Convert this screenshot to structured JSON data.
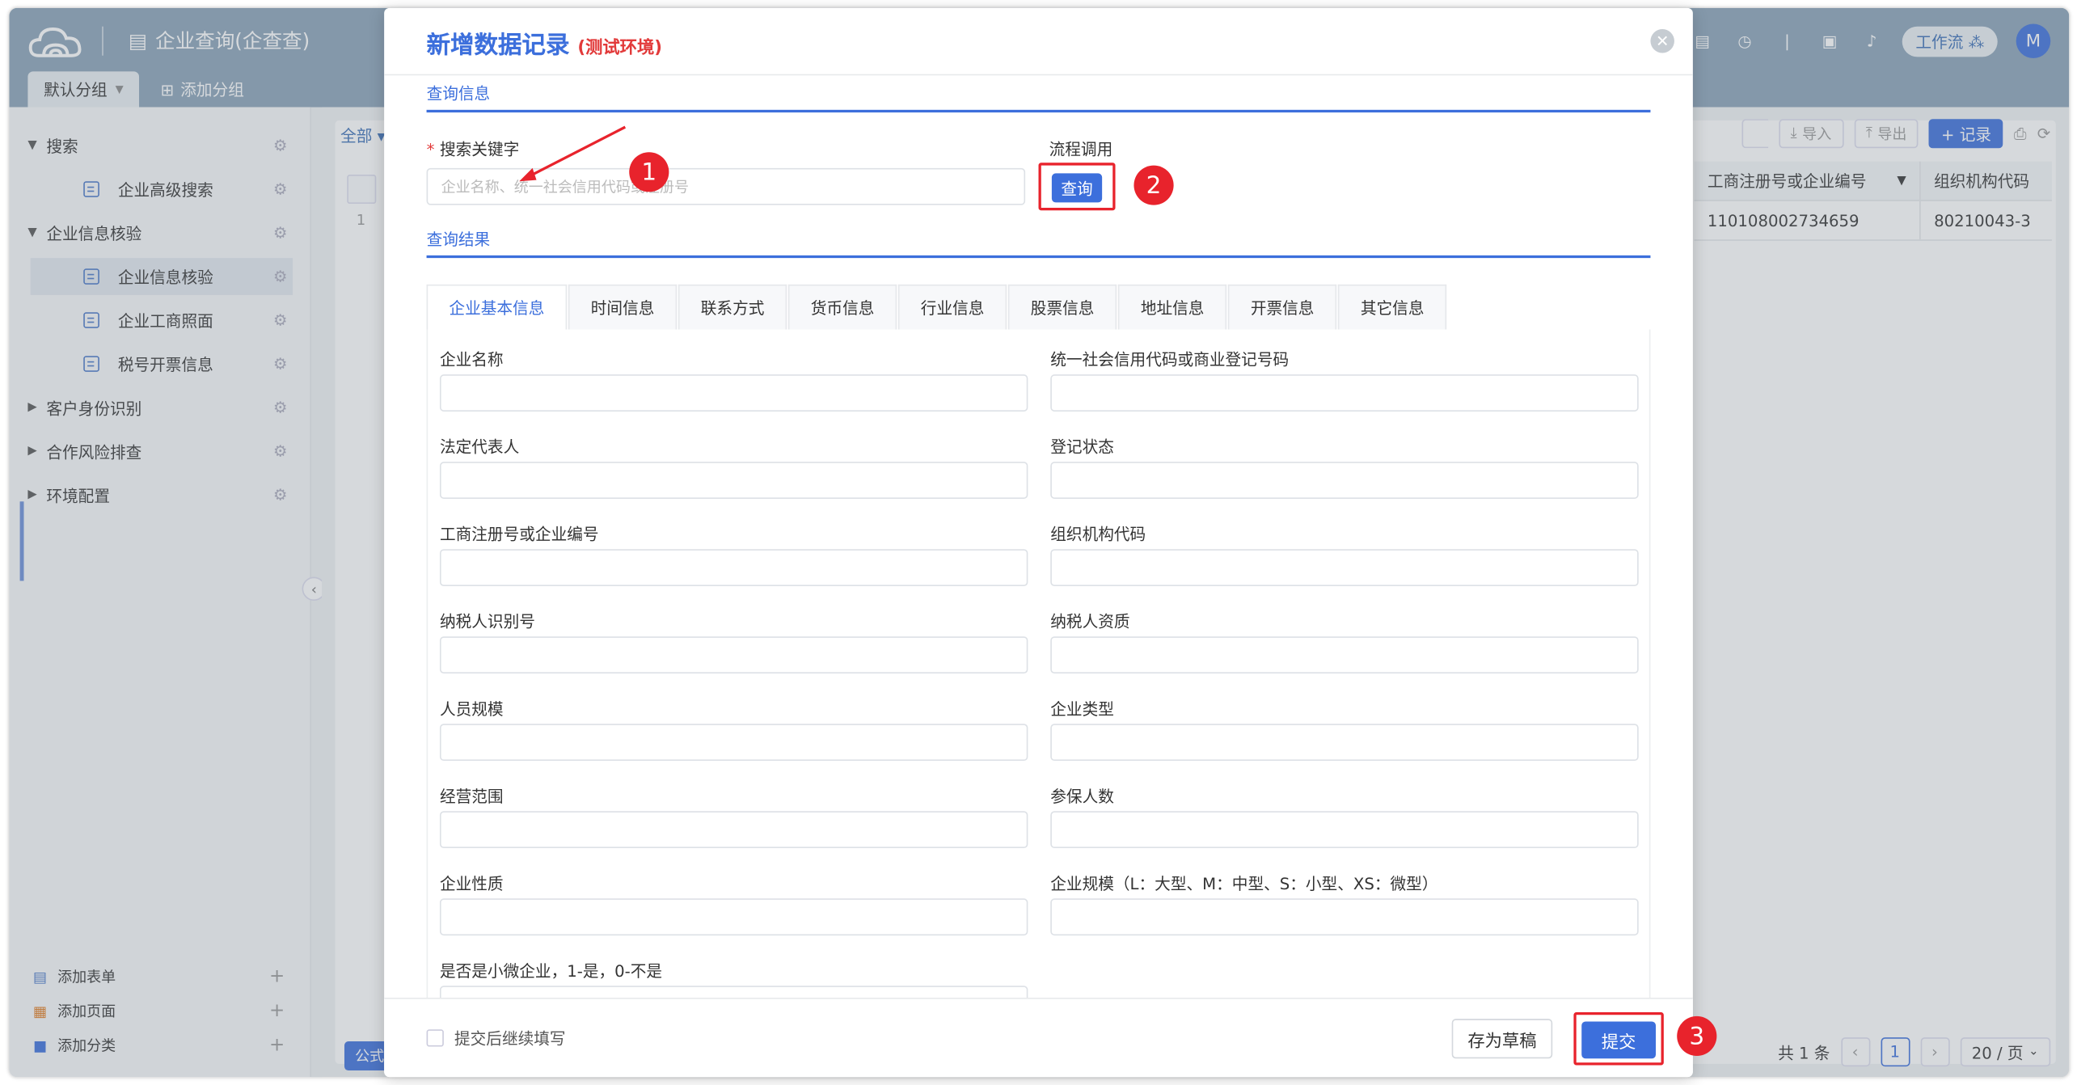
{
  "app": {
    "title": "企业查询(企查查)",
    "tabs": {
      "default_group": "默认分组",
      "add_group": "添加分组"
    },
    "workflow_button": "工作流",
    "avatar_initial": "M"
  },
  "sidebar": {
    "search": "搜索",
    "advanced_search": "企业高级搜索",
    "info_verify": "企业信息核验",
    "info_verify_item": "企业信息核验",
    "biz_photo": "企业工商照面",
    "tax_invoice": "税号开票信息",
    "identity": "客户身份识别",
    "risk": "合作风险排查",
    "env_config": "环境配置",
    "add_form": "添加表单",
    "add_page": "添加页面",
    "add_category": "添加分类"
  },
  "main": {
    "filter_all": "全部",
    "import": "导入",
    "export": "导出",
    "record": "+ 记录",
    "columns": [
      "工商注册号或企业编号",
      "组织机构代码"
    ],
    "row_index": "1",
    "row_values": [
      "110108002734659",
      "80210043-3"
    ],
    "total": "共 1 条",
    "page": "1",
    "page_size": "20 / 页",
    "formula_btn": "公式栏"
  },
  "modal": {
    "title": "新增数据记录",
    "env": "(测试环境)",
    "section_query": "查询信息",
    "keyword_label": "搜索关键字",
    "keyword_placeholder": "企业名称、统一社会信用代码或注册号",
    "flow_label": "流程调用",
    "query_btn": "查询",
    "section_result": "查询结果",
    "tabs": [
      "企业基本信息",
      "时间信息",
      "联系方式",
      "货币信息",
      "行业信息",
      "股票信息",
      "地址信息",
      "开票信息",
      "其它信息"
    ],
    "fields": [
      "企业名称",
      "统一社会信用代码或商业登记号码",
      "法定代表人",
      "登记状态",
      "工商注册号或企业编号",
      "组织机构代码",
      "纳税人识别号",
      "纳税人资质",
      "人员规模",
      "企业类型",
      "经营范围",
      "参保人数",
      "企业性质",
      "企业规模（L：大型、M：中型、S：小型、XS：微型）",
      "是否是小微企业，1-是，0-不是"
    ],
    "continue_label": "提交后继续填写",
    "draft_btn": "存为草稿",
    "submit_btn": "提交"
  },
  "annotations": [
    "1",
    "2",
    "3"
  ],
  "colors": {
    "accent": "#3c6fdc",
    "highlight": "#e8232c",
    "topbar": "#8aa3b8"
  }
}
